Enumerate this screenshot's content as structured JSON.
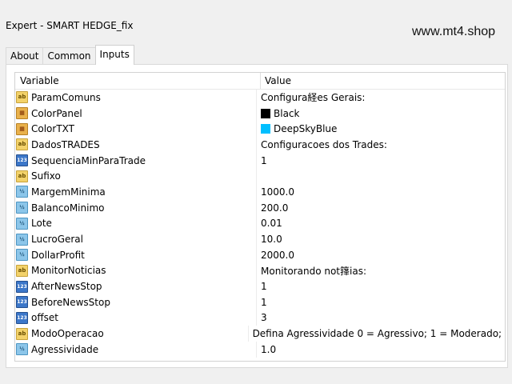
{
  "window": {
    "title": "Expert - SMART HEDGE_fix"
  },
  "watermark": "www.mt4.shop",
  "tabs": [
    {
      "label": "About"
    },
    {
      "label": "Common"
    },
    {
      "label": "Inputs",
      "active": true
    }
  ],
  "table": {
    "headers": {
      "variable": "Variable",
      "value": "Value"
    },
    "rows": [
      {
        "variable": "ParamComuns",
        "icon": "ab",
        "value": "Configura経es Gerais:"
      },
      {
        "variable": "ColorPanel",
        "icon": "color",
        "value": "Black",
        "swatch": "#000000"
      },
      {
        "variable": "ColorTXT",
        "icon": "color",
        "value": "DeepSkyBlue",
        "swatch": "#00bfff"
      },
      {
        "variable": "DadosTRADES",
        "icon": "ab",
        "value": "Configuracoes dos Trades:"
      },
      {
        "variable": "SequenciaMinParaTrade",
        "icon": "int",
        "value": "1"
      },
      {
        "variable": "Sufixo",
        "icon": "ab",
        "value": ""
      },
      {
        "variable": "MargemMinima",
        "icon": "double",
        "value": "1000.0"
      },
      {
        "variable": "BalancoMinimo",
        "icon": "double",
        "value": "200.0"
      },
      {
        "variable": "Lote",
        "icon": "double",
        "value": "0.01"
      },
      {
        "variable": "LucroGeral",
        "icon": "double",
        "value": "10.0"
      },
      {
        "variable": "DollarProfit",
        "icon": "double",
        "value": "2000.0"
      },
      {
        "variable": "MonitorNoticias",
        "icon": "ab",
        "value": "Monitorando not箨ias:"
      },
      {
        "variable": "AfterNewsStop",
        "icon": "int",
        "value": "1"
      },
      {
        "variable": "BeforeNewsStop",
        "icon": "int",
        "value": "1"
      },
      {
        "variable": "offset",
        "icon": "int",
        "value": "3"
      },
      {
        "variable": "ModoOperacao",
        "icon": "ab",
        "value": "Defina Agressividade 0 = Agressivo; 1 = Moderado; ..."
      },
      {
        "variable": "Agressividade",
        "icon": "double",
        "value": "1.0"
      }
    ]
  }
}
